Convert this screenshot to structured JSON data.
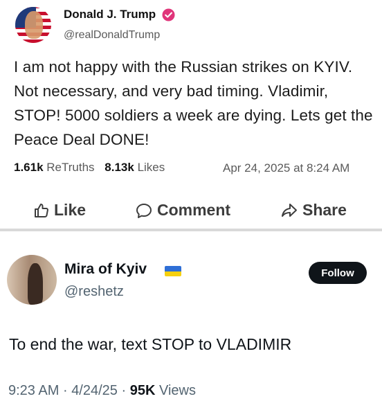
{
  "post_truth": {
    "author_name": "Donald J. Trump",
    "handle": "@realDonaldTrump",
    "body": "I am not happy with the Russian strikes on KYIV. Not necessary, and very bad timing. Vladimir, STOP! 5000 soldiers a week are dying. Lets get the Peace Deal DONE!",
    "retruths_count": "1.61k",
    "retruths_label": "ReTruths",
    "likes_count": "8.13k",
    "likes_label": "Likes",
    "timestamp": "Apr 24, 2025 at 8:24 AM",
    "actions": {
      "like": "Like",
      "comment": "Comment",
      "share": "Share"
    },
    "verified_color": "#e0357a"
  },
  "post_x": {
    "author_name": "Mira of Kyiv",
    "handle": "@reshetz",
    "follow_label": "Follow",
    "body": "To end the war, text STOP to VLADIMIR",
    "time": "9:23 AM",
    "separator": "·",
    "date": "4/24/25",
    "views_count": "95K",
    "views_label": "Views",
    "flag_colors": [
      "#2f6fd6",
      "#f5d00f"
    ]
  }
}
